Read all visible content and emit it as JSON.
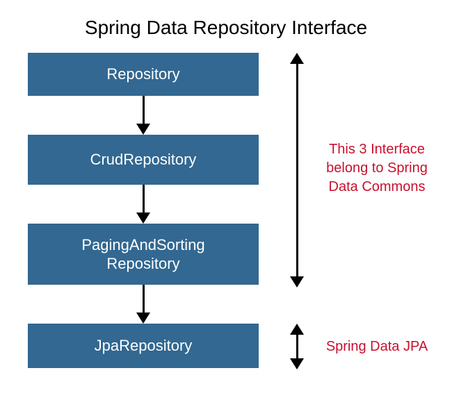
{
  "title": "Spring Data Repository Interface",
  "boxes": {
    "b1": "Repository",
    "b2": "CrudRepository",
    "b3_line1": "PagingAndSorting",
    "b3_line2": "Repository",
    "b4": "JpaRepository"
  },
  "annotations": {
    "a1_line1": "This 3 Interface",
    "a1_line2": "belong to Spring",
    "a1_line3": "Data Commons",
    "a2": "Spring Data JPA"
  },
  "colors": {
    "box_bg": "#326891",
    "annotation": "#c8102e"
  }
}
